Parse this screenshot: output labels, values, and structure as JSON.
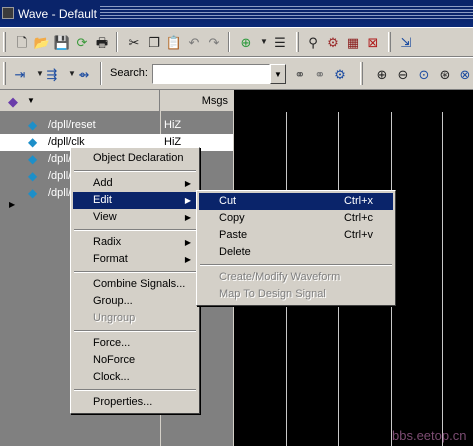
{
  "window": {
    "title": "Wave - Default"
  },
  "toolbar1": {
    "icons": [
      "new-file-icon",
      "open-folder-icon",
      "save-icon",
      "reload-icon",
      "print-icon",
      "cut-icon",
      "copy-icon",
      "paste-icon",
      "undo-icon",
      "redo-icon",
      "add-icon",
      "dropdown-icon",
      "tree-icon",
      "find-icon",
      "compile-icon",
      "simulate-icon",
      "break-icon",
      "exit-icon"
    ]
  },
  "toolbar2": {
    "search_label": "Search:",
    "search_value": "",
    "icons": [
      "step-icon",
      "step-into-icon",
      "step-over-icon",
      "find-binoculars-icon",
      "find-next-icon",
      "compare-icon",
      "zoom-in-icon",
      "zoom-out-icon",
      "zoom-fit-icon",
      "zoom-full-icon"
    ]
  },
  "panes": {
    "msgs_header": "Msgs"
  },
  "signals": [
    {
      "name": "/dpll/reset",
      "value": "HiZ",
      "selected": false
    },
    {
      "name": "/dpll/clk",
      "value": "HiZ",
      "selected": true
    },
    {
      "name": "/dpll/",
      "value": "",
      "selected": false
    },
    {
      "name": "/dpll/",
      "value": "",
      "selected": false
    },
    {
      "name": "/dpll/",
      "value": "",
      "selected": false
    }
  ],
  "context_menu": {
    "items": [
      {
        "label": "Object Declaration",
        "submenu": false,
        "disabled": false
      },
      {
        "sep": true
      },
      {
        "label": "Add",
        "submenu": true,
        "disabled": false
      },
      {
        "label": "Edit",
        "submenu": true,
        "disabled": false,
        "highlighted": true
      },
      {
        "label": "View",
        "submenu": true,
        "disabled": false
      },
      {
        "sep": true
      },
      {
        "label": "Radix",
        "submenu": true,
        "disabled": false
      },
      {
        "label": "Format",
        "submenu": true,
        "disabled": false
      },
      {
        "sep": true
      },
      {
        "label": "Combine Signals...",
        "submenu": false,
        "disabled": false
      },
      {
        "label": "Group...",
        "submenu": false,
        "disabled": false
      },
      {
        "label": "Ungroup",
        "submenu": false,
        "disabled": true
      },
      {
        "sep": true
      },
      {
        "label": "Force...",
        "submenu": false,
        "disabled": false
      },
      {
        "label": "NoForce",
        "submenu": false,
        "disabled": false
      },
      {
        "label": "Clock...",
        "submenu": false,
        "disabled": false
      },
      {
        "sep": true
      },
      {
        "label": "Properties...",
        "submenu": false,
        "disabled": false
      }
    ]
  },
  "edit_submenu": {
    "items": [
      {
        "label": "Cut",
        "shortcut": "Ctrl+x",
        "disabled": false,
        "highlighted": true
      },
      {
        "label": "Copy",
        "shortcut": "Ctrl+c",
        "disabled": false
      },
      {
        "label": "Paste",
        "shortcut": "Ctrl+v",
        "disabled": false
      },
      {
        "label": "Delete",
        "shortcut": "",
        "disabled": false
      },
      {
        "sep": true
      },
      {
        "label": "Create/Modify Waveform",
        "shortcut": "",
        "disabled": true
      },
      {
        "label": "Map To Design Signal",
        "shortcut": "",
        "disabled": true
      }
    ]
  },
  "watermark": "bbs.eetop.cn",
  "colors": {
    "titlebar": "#0a246a",
    "menu_highlight": "#0a246a",
    "wave_bg": "#000000",
    "signal_icon": "#1d8fc9"
  }
}
